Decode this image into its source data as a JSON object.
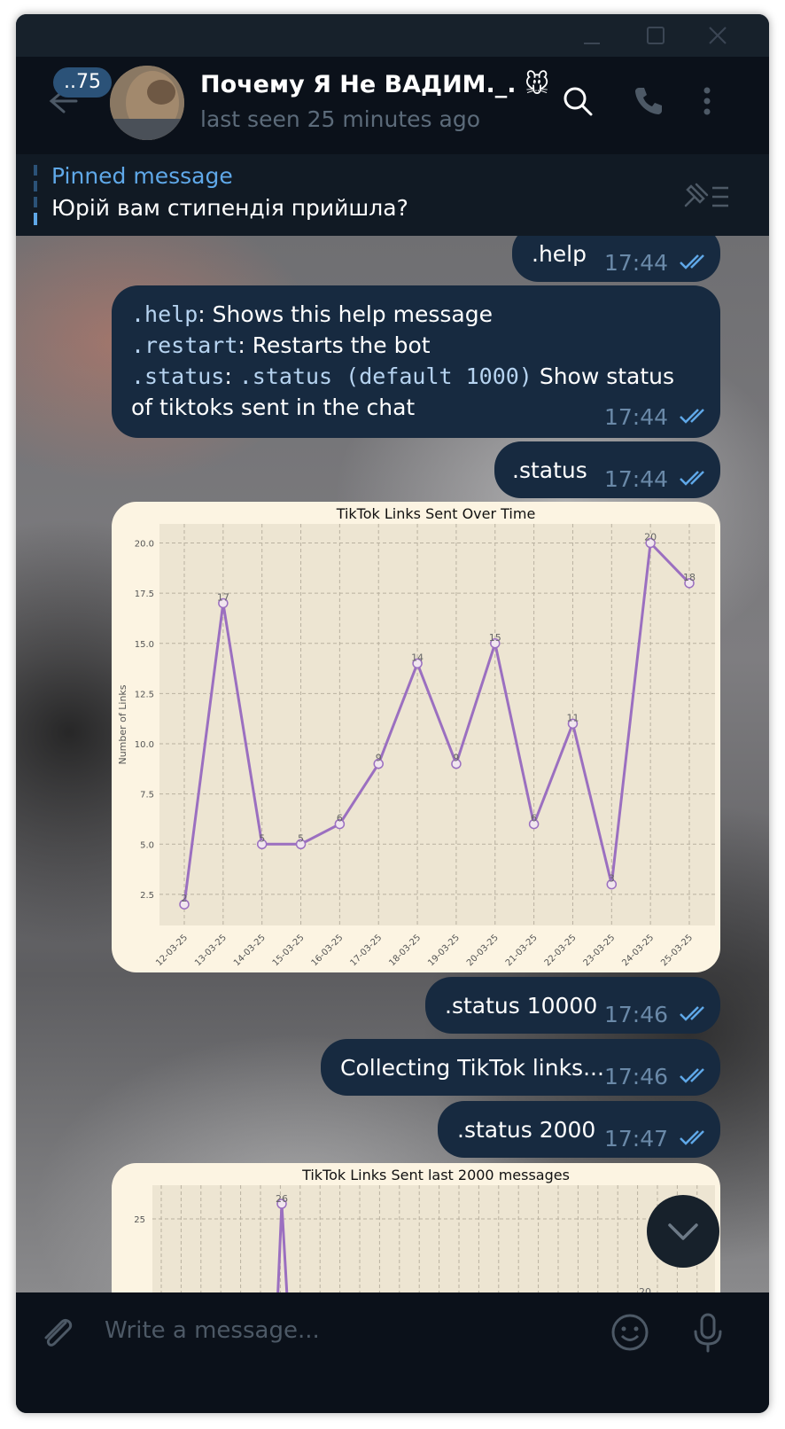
{
  "window": {
    "minimize": "minimize",
    "maximize": "maximize",
    "close": "close"
  },
  "header": {
    "back_icon": "arrow-left-icon",
    "unread_count": "..75",
    "title": "Почему Я Не ВАДИМ._. 🐭",
    "status": "last seen 25 minutes ago",
    "icons": [
      "search-icon",
      "phone-icon",
      "more-vertical-icon"
    ]
  },
  "pinned": {
    "label": "Pinned message",
    "text": "Юрій вам стипендія прийшла?"
  },
  "messages": {
    "m1": {
      "text": ".help",
      "time": "17:44"
    },
    "m2": {
      "line1_cmd": ".help",
      "line1_desc": ":  Shows this help message",
      "line2_cmd": ".restart",
      "line2_desc": ":  Restarts the bot",
      "line3_cmd": ".status",
      "line3_sep": ": ",
      "line3_arg": ".status  (default 1000)",
      "line3_desc": " Show status",
      "line4": "of tiktoks sent in the chat",
      "time": "17:44"
    },
    "m3": {
      "text": ".status",
      "time": "17:44"
    },
    "m5": {
      "text": ".status 10000",
      "time": "17:46"
    },
    "m6": {
      "text": "Collecting TikTok links...",
      "time": "17:46"
    },
    "m7": {
      "text": ".status 2000",
      "time": "17:47"
    }
  },
  "composer": {
    "placeholder": "Write a message...",
    "icons": [
      "paperclip-icon",
      "emoji-icon",
      "microphone-icon"
    ]
  },
  "colors": {
    "accent": "#5fa8e8",
    "bubble": "#172a40",
    "line": "#9b6fc0",
    "chart_bg": "#fcf4e2",
    "plot_bg": "#ede5d2"
  },
  "chart_data": [
    {
      "type": "line",
      "title": "TikTok Links Sent Over Time",
      "xlabel": "",
      "ylabel": "Number of Links",
      "categories": [
        "12-03-25",
        "13-03-25",
        "14-03-25",
        "15-03-25",
        "16-03-25",
        "17-03-25",
        "18-03-25",
        "19-03-25",
        "20-03-25",
        "21-03-25",
        "22-03-25",
        "23-03-25",
        "24-03-25",
        "25-03-25"
      ],
      "values": [
        2,
        17,
        5,
        5,
        6,
        9,
        14,
        9,
        15,
        6,
        11,
        3,
        20,
        18
      ],
      "yticks": [
        "2.5",
        "5.0",
        "7.5",
        "10.0",
        "12.5",
        "15.0",
        "17.5",
        "20.0"
      ],
      "ylim": [
        0.95,
        20.95
      ],
      "grid": true
    },
    {
      "type": "line",
      "title": "TikTok Links Sent last 2000 messages",
      "visible_yticks": [
        "25"
      ],
      "visible_point_labels": [
        "26",
        "20"
      ],
      "grid": true
    }
  ]
}
